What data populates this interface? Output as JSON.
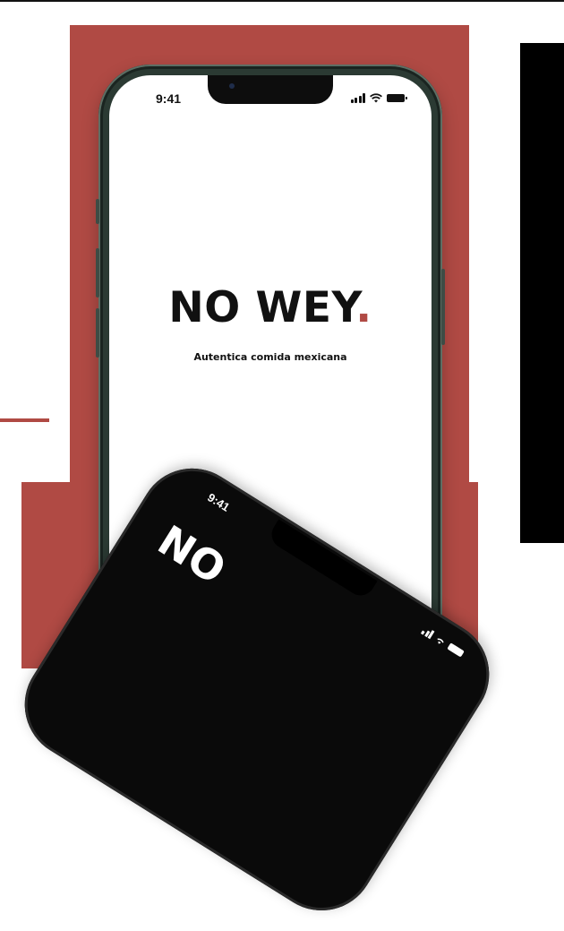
{
  "colors": {
    "accent": "#b04a44",
    "dark": "#000000"
  },
  "phone": {
    "status_time": "9:41",
    "brand_name": "NO WEY",
    "brand_dot": ".",
    "tagline": "Autentica comida mexicana"
  },
  "phone_secondary": {
    "status_time": "9:41",
    "brand_fragment": "NO"
  },
  "icons": [
    "signal-icon",
    "wifi-icon",
    "battery-icon"
  ]
}
